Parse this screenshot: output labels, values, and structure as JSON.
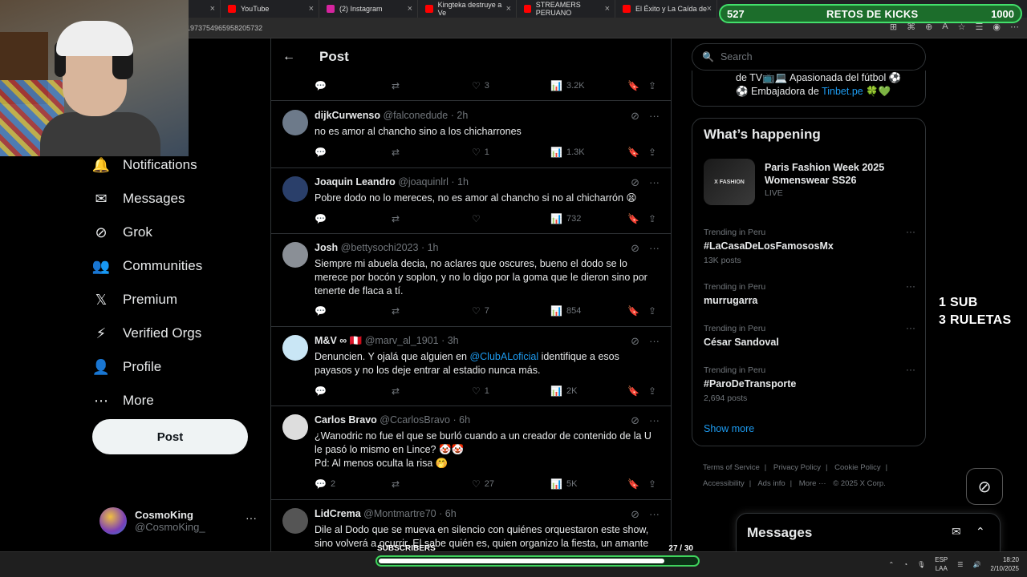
{
  "browser": {
    "tabs": [
      {
        "label": "",
        "color": "#444"
      },
      {
        "label": "YouTube",
        "color": "#ff0000"
      },
      {
        "label": "(2) Instagram",
        "color": "#d6249f"
      },
      {
        "label": "Kingteka destruye a Ve",
        "color": "#ff0000"
      },
      {
        "label": "STREAMERS PERUANO",
        "color": "#ff0000"
      },
      {
        "label": "El Éxito y La Caída de",
        "color": "#ff0000"
      }
    ],
    "url_fragment": "1973754965958205732"
  },
  "overlay": {
    "retos_left": "527",
    "retos_label": "RETOS DE KICKS",
    "retos_right": "1000",
    "retos_progress": 0.527,
    "sub_line1": "1 SUB",
    "sub_line2": "3 RULETAS",
    "subscribers_label": "SUBSCRIBERS",
    "subscribers_value": "27 / 30",
    "subscribers_progress": 0.9
  },
  "nav": {
    "items": [
      {
        "label": "Notifications",
        "icon": "bell-icon",
        "glyph": "🔔"
      },
      {
        "label": "Messages",
        "icon": "envelope-icon",
        "glyph": "✉"
      },
      {
        "label": "Grok",
        "icon": "grok-icon",
        "glyph": "⊘"
      },
      {
        "label": "Communities",
        "icon": "communities-icon",
        "glyph": "👥"
      },
      {
        "label": "Premium",
        "icon": "x-logo-icon",
        "glyph": "𝕏"
      },
      {
        "label": "Verified Orgs",
        "icon": "lightning-icon",
        "glyph": "⚡"
      },
      {
        "label": "Profile",
        "icon": "person-icon",
        "glyph": "👤"
      },
      {
        "label": "More",
        "icon": "more-circle-icon",
        "glyph": "⋯"
      }
    ],
    "post_button": "Post",
    "account_name": "CosmoKing",
    "account_handle": "@CosmoKing_"
  },
  "center": {
    "title": "Post",
    "top_actions": {
      "likes": "3",
      "views": "3.2K"
    },
    "tweets": [
      {
        "name": "dijkCurwenso",
        "handle": "@falconedude",
        "time": "· 2h",
        "text": [
          "no es amor al chancho sino a los chicharrones"
        ],
        "replies": "",
        "likes": "1",
        "views": "1.3K",
        "avatar": "#6d7a8a"
      },
      {
        "name": "Joaquin Leandro",
        "handle": "@joaquinlrl",
        "time": "· 1h",
        "text": [
          "Pobre dodo no lo mereces, no es amor al chancho si no al chicharrón 😫"
        ],
        "replies": "",
        "likes": "",
        "views": "732",
        "avatar": "#2a3f6a"
      },
      {
        "name": "Josh",
        "handle": "@bettysochi2023",
        "time": "· 1h",
        "text": [
          "Siempre mi abuela decia, no aclares que oscures, bueno el dodo se lo",
          "merece por bocón y soplon, y no lo digo por la goma que le dieron sino por",
          "tenerte de flaca a tí."
        ],
        "replies": "",
        "likes": "7",
        "views": "854",
        "avatar": "#8a8f96"
      },
      {
        "name": "M&V ∞ 🇵🇪",
        "handle": "@marv_al_1901",
        "time": "· 3h",
        "text_pre": "Denuncien. Y ojalá que alguien en ",
        "mention": "@ClubALoficial",
        "text_post": " identifique a esos",
        "text2": "payasos y no los deje entrar al estadio nunca más.",
        "replies": "",
        "likes": "1",
        "views": "2K",
        "avatar": "#c9e6f5"
      },
      {
        "name": "Carlos Bravo",
        "handle": "@CcarlosBravo",
        "time": "· 6h",
        "text": [
          "¿Wanodric no fue el que se burló cuando a un creador de contenido de la U",
          "le pasó lo mismo en Lince? 🤡🤡",
          "Pd: Al menos oculta la risa 🤭"
        ],
        "replies": "2",
        "likes": "27",
        "views": "5K",
        "avatar": "#dddddd"
      },
      {
        "name": "LidCrema",
        "handle": "@Montmartre70",
        "time": "· 6h",
        "text": [
          "Dile al Dodo que se mueva en silencio con quiénes orquestaron este show,",
          "sino volverá a ocurrir. El sabe quién es, quien organizo la fiesta, un amante"
        ],
        "replies": "",
        "likes": "",
        "views": "",
        "avatar": "#555555"
      }
    ]
  },
  "right": {
    "search_placeholder": "Search",
    "bio_line1": "de TV📺💻 Apasionada del fútbol ⚽",
    "bio_line2_pre": "⚽ Embajadora de ",
    "bio_link": "Tinbet.pe",
    "bio_line2_post": " 🍀💚",
    "happening_title": "What’s happening",
    "featured": {
      "title": "Paris Fashion Week 2025 Womenswear SS26",
      "status": "LIVE",
      "thumb_label": "X FASHION"
    },
    "trends": [
      {
        "context": "Trending in Peru",
        "title": "#LaCasaDeLosFamososMx",
        "count": "13K posts"
      },
      {
        "context": "Trending in Peru",
        "title": "murrugarra",
        "count": ""
      },
      {
        "context": "Trending in Peru",
        "title": "César Sandoval",
        "count": ""
      },
      {
        "context": "Trending in Peru",
        "title": "#ParoDeTransporte",
        "count": "2,694 posts"
      }
    ],
    "show_more": "Show more",
    "footer": [
      "Terms of Service",
      "|",
      "Privacy Policy",
      "|",
      "Cookie Policy",
      "|",
      "Accessibility",
      "|",
      "Ads info",
      "|",
      "More ···",
      "© 2025 X Corp."
    ],
    "messages_title": "Messages"
  },
  "taskbar": {
    "lang1": "ESP",
    "lang2": "LAA",
    "time": "18:20",
    "date": "2/10/2025"
  }
}
